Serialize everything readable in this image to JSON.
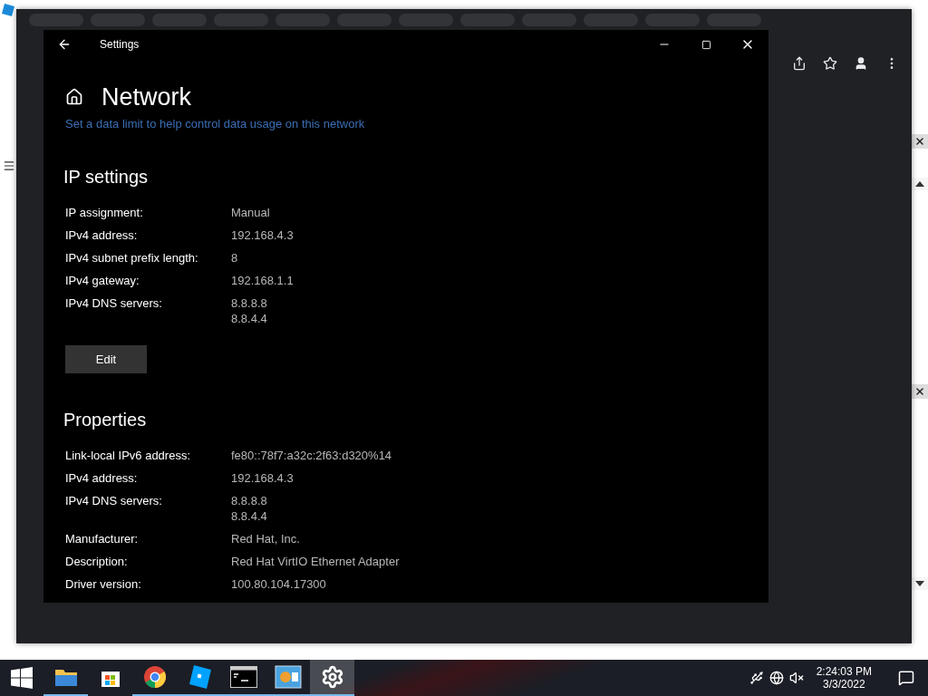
{
  "settings_window": {
    "title": "Settings",
    "page_title": "Network",
    "link": "Set a data limit to help control data usage on this network",
    "sections": [
      {
        "heading": "IP settings",
        "rows": [
          {
            "label": "IP assignment:",
            "values": [
              "Manual"
            ]
          },
          {
            "label": "IPv4 address:",
            "values": [
              "192.168.4.3"
            ]
          },
          {
            "label": "IPv4 subnet prefix length:",
            "values": [
              "8"
            ]
          },
          {
            "label": "IPv4 gateway:",
            "values": [
              "192.168.1.1"
            ]
          },
          {
            "label": "IPv4 DNS servers:",
            "values": [
              "8.8.8.8",
              "8.8.4.4"
            ]
          }
        ],
        "button": "Edit"
      },
      {
        "heading": "Properties",
        "rows": [
          {
            "label": "Link-local IPv6 address:",
            "values": [
              "fe80::78f7:a32c:2f63:d320%14"
            ]
          },
          {
            "label": "IPv4 address:",
            "values": [
              "192.168.4.3"
            ]
          },
          {
            "label": "IPv4 DNS servers:",
            "values": [
              "8.8.8.8",
              "8.8.4.4"
            ]
          },
          {
            "label": "Manufacturer:",
            "values": [
              "Red Hat, Inc."
            ]
          },
          {
            "label": "Description:",
            "values": [
              "Red Hat VirtIO Ethernet Adapter"
            ]
          },
          {
            "label": "Driver version:",
            "values": [
              "100.80.104.17300"
            ]
          }
        ]
      }
    ]
  },
  "taskbar": {
    "apps": [
      {
        "kind": "folder",
        "running": true,
        "selected": false
      },
      {
        "kind": "store",
        "running": false,
        "selected": false
      },
      {
        "kind": "chrome",
        "running": true,
        "selected": false
      },
      {
        "kind": "studio",
        "running": true,
        "selected": false
      },
      {
        "kind": "terminal",
        "running": true,
        "selected": false
      },
      {
        "kind": "monitor",
        "running": true,
        "selected": false
      },
      {
        "kind": "gear",
        "running": true,
        "selected": true
      }
    ],
    "time": "2:24:03 PM",
    "date": "3/3/2022"
  }
}
